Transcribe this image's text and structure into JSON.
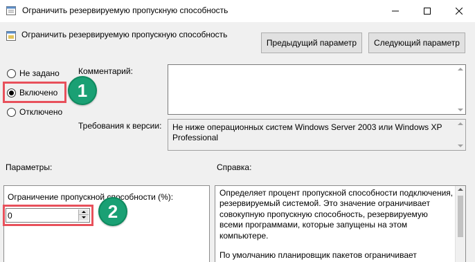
{
  "window": {
    "title": "Ограничить резервируемую пропускную способность",
    "minimize_icon": "minimize-icon",
    "maximize_icon": "maximize-icon",
    "close_icon": "close-icon"
  },
  "header": {
    "setting_name": "Ограничить резервируемую пропускную способность",
    "prev_button": "Предыдущий параметр",
    "next_button": "Следующий параметр"
  },
  "state": {
    "options": [
      "Не задано",
      "Включено",
      "Отключено"
    ],
    "selected": "Включено"
  },
  "comment": {
    "label": "Комментарий:",
    "value": ""
  },
  "version": {
    "label": "Требования к версии:",
    "value": "Не ниже операционных систем Windows Server 2003 или Windows XP Professional"
  },
  "params": {
    "label": "Параметры:",
    "field_label": "Ограничение пропускной способности (%):",
    "field_value": "0"
  },
  "help": {
    "label": "Справка:",
    "paragraphs": [
      "Определяет процент пропускной способности подключения, резервируемый системой. Это значение ограничивает совокупную пропускную способность, резервируемую всеми программами, которые запущены на этом компьютере.",
      "По умолчанию планировщик пакетов ограничивает"
    ]
  },
  "annotations": {
    "badge1": "1",
    "badge2": "2",
    "highlight_color": "#e8505b",
    "badge_color": "#1aa074"
  }
}
